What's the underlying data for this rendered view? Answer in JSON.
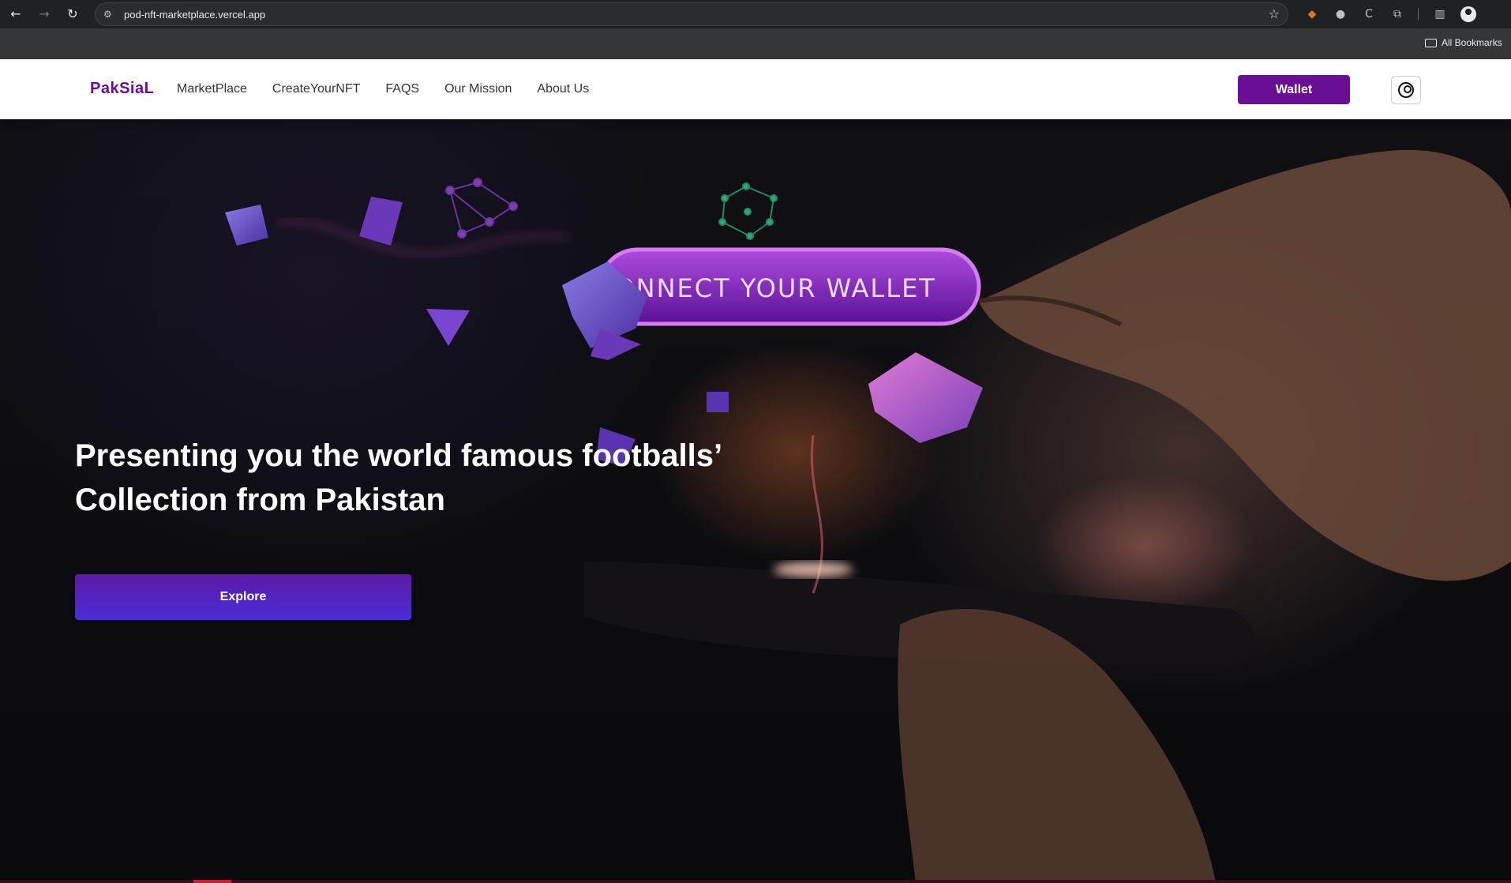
{
  "browser": {
    "url": "pod-nft-marketplace.vercel.app",
    "bookmarks_label": "All Bookmarks"
  },
  "navbar": {
    "logo": "PakSiaL",
    "menu": [
      {
        "label": "MarketPlace"
      },
      {
        "label": "CreateYourNFT"
      },
      {
        "label": "FAQS"
      },
      {
        "label": "Our Mission"
      },
      {
        "label": "About Us"
      }
    ],
    "wallet_label": "Wallet"
  },
  "hero": {
    "title_line1": "Presenting you the world famous footballs’",
    "title_line2": "Collection from Pakistan",
    "explore_label": "Explore",
    "image_text": "CONNECT YOUR WALLET"
  },
  "colors": {
    "brand": "#690e95",
    "explore_gradient_start": "#5d19a6",
    "explore_gradient_end": "#4a2ed6"
  }
}
